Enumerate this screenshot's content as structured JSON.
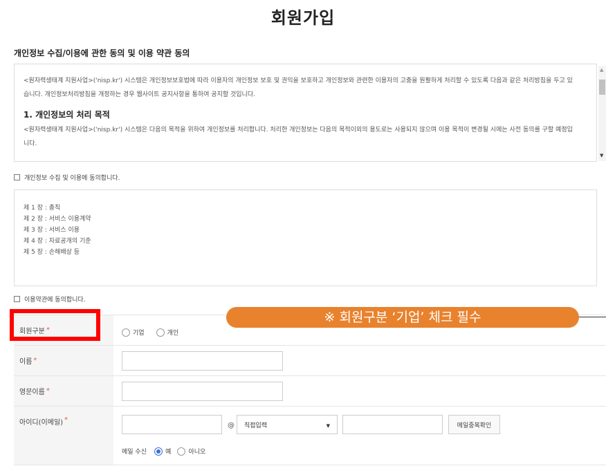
{
  "page": {
    "title": "회원가입"
  },
  "privacy": {
    "section_title": "개인정보 수집/이용에 관한 동의 및 이용 약관 동의",
    "intro": "<원자력생태계 지원사업>('nisp.kr') 시스템은 개인정보보호법에 따라 이용자의 개인정보 보호 및 권익을 보호하고 개인정보와 관련한 이용자의 고충을 원활하게 처리할 수 있도록 다음과 같은 처리방침을 두고 있습니다. 개인정보처리방침을 개정하는 경우 웹사이트 공지사항을 통하여 공지할 것입니다.",
    "heading": "1. 개인정보의 처리 목적",
    "body": "<원자력생태계 지원사업>('nisp.kr') 시스템은 다음의 목적을 위하여 개인정보를 처리합니다. 처리한 개인정보는 다음의 목적이외의 용도로는 사용되지 않으며 이용 목적이 변경될 시에는 사전 동의를 구할 예정입니다.",
    "agree_label": "개인정보 수집 및 이용에 동의합니다."
  },
  "terms": {
    "chapters": [
      "제 1 장 : 총칙",
      "제 2 장 : 서비스 이용계약",
      "제 3 장 : 서비스 이용",
      "제 4 장 : 자료공개의 기준",
      "제 5 장 : 손해배상 등"
    ],
    "agree_label": "이용약관에 동의합니다."
  },
  "form": {
    "member_type": {
      "label": "회원구분",
      "options": [
        "기업",
        "개인"
      ]
    },
    "name": {
      "label": "이름"
    },
    "eng_name": {
      "label": "영문이름"
    },
    "email": {
      "label": "아이디(이메일)",
      "at": "@",
      "domain_select": "직접입력",
      "check_button": "메일중복확인",
      "subscribe_label": "메일 수신",
      "subscribe_options": [
        "예",
        "아니오"
      ],
      "subscribe_selected": "예"
    },
    "required_mark": "*"
  },
  "annotation": {
    "notice": "※ 회원구분 ‘기업’ 체크 필수",
    "colors": {
      "highlight_box": "#ff0000",
      "notice_bg": "#e8822d"
    }
  }
}
